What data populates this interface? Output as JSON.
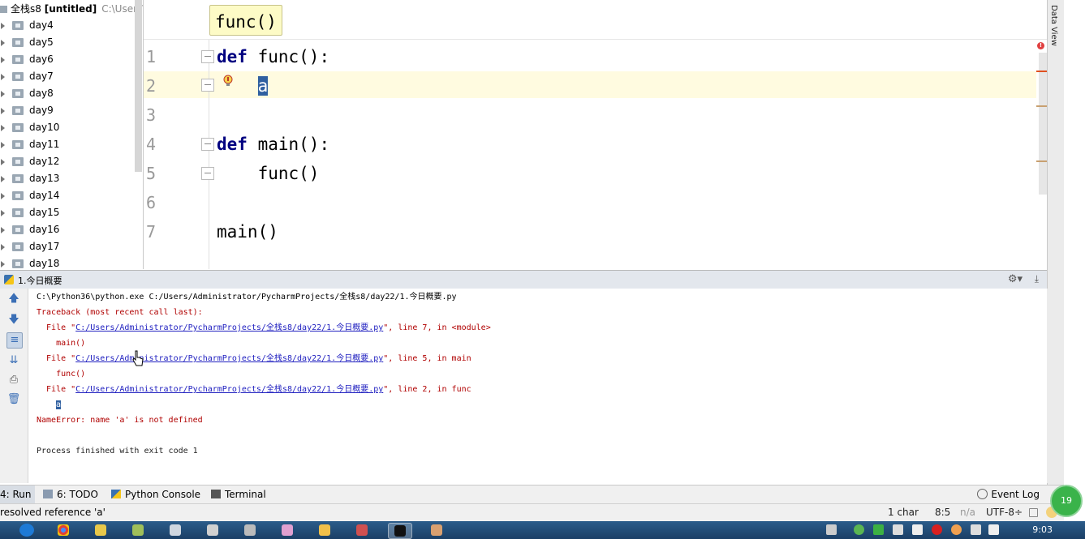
{
  "project": {
    "name": "全栈s8",
    "tag": "[untitled]",
    "path": "C:\\Users\\",
    "folders": [
      "day4",
      "day5",
      "day6",
      "day7",
      "day8",
      "day9",
      "day10",
      "day11",
      "day12",
      "day13",
      "day14",
      "day15",
      "day16",
      "day17",
      "day18"
    ]
  },
  "editor": {
    "tooltip": "func()",
    "line_numbers": [
      "1",
      "2",
      "3",
      "4",
      "5",
      "6",
      "7"
    ],
    "lines": [
      {
        "kw": "def",
        "text": " func():"
      },
      {
        "kw": "",
        "text": "    ",
        "selected": "a"
      },
      {
        "kw": "",
        "text": ""
      },
      {
        "kw": "def",
        "text": " main():"
      },
      {
        "kw": "",
        "text": "    func()"
      },
      {
        "kw": "",
        "text": ""
      },
      {
        "kw": "",
        "text": "main()"
      }
    ],
    "right_panel": "Data View"
  },
  "run": {
    "tab_title": "1.今日概要",
    "console": {
      "cmd": "C:\\Python36\\python.exe C:/Users/Administrator/PycharmProjects/全栈s8/day22/1.今日概要.py",
      "traceback": "Traceback (most recent call last):",
      "frames": [
        {
          "prefix": "  File \"",
          "file": "C:/Users/Administrator/PycharmProjects/全栈s8/day22/1.今日概要.py",
          "suffix": "\", line 7, in <module>",
          "code": "    main()"
        },
        {
          "prefix": "  File \"",
          "file": "C:/Users/Administrator/PycharmProjects/全栈s8/day22/1.今日概要.py",
          "suffix": "\", line 5, in main",
          "code": "    func()"
        },
        {
          "prefix": "  File \"",
          "file": "C:/Users/Administrator/PycharmProjects/全栈s8/day22/1.今日概要.py",
          "suffix": "\", line 2, in func",
          "code": "a"
        }
      ],
      "error": "NameError: name 'a' is not defined",
      "exit": "Process finished with exit code 1"
    }
  },
  "tooltabs": {
    "run": "4: Run",
    "todo": "6: TODO",
    "console": "Python Console",
    "terminal": "Terminal",
    "eventlog": "Event Log"
  },
  "status": {
    "message": "resolved reference 'a'",
    "chars": "1 char",
    "position": "8:5",
    "na": "n/a",
    "encoding": "UTF-8÷"
  },
  "badge": "19",
  "taskbar": {
    "clock": "9:03"
  },
  "colors": {
    "keyword": "#000080",
    "error": "#b00000",
    "link": "#2020c0",
    "selection": "#3060a0",
    "current_line": "#fffbe0",
    "taskbar": "#1b3f66"
  }
}
